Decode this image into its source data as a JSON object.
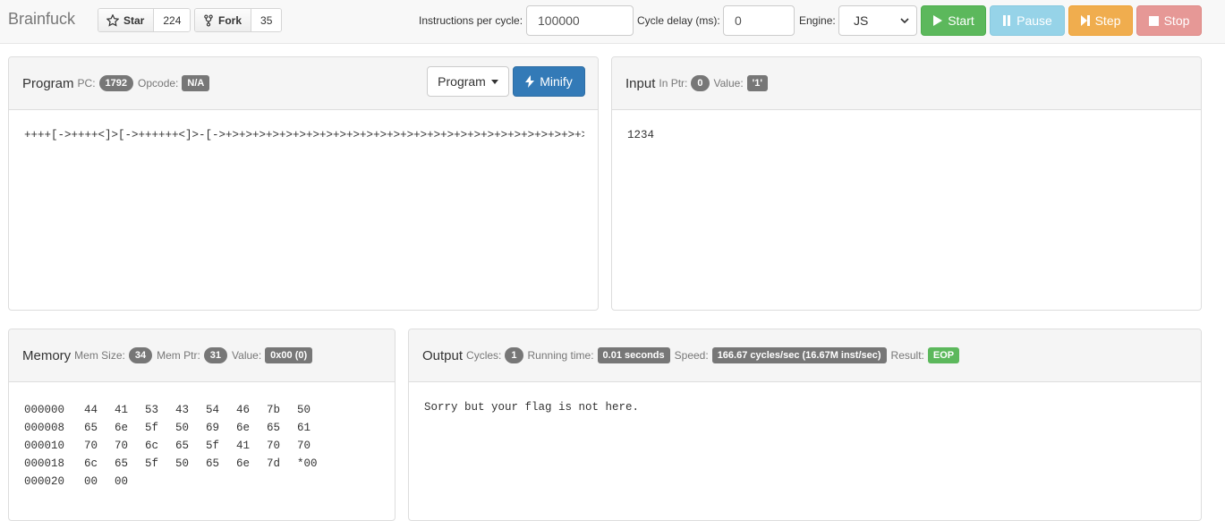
{
  "navbar": {
    "brand": "Brainfuck",
    "star": {
      "label": "Star",
      "count": "224"
    },
    "fork": {
      "label": "Fork",
      "count": "35"
    },
    "ipc_label": "Instructions per cycle:",
    "ipc_value": "100000",
    "delay_label": "Cycle delay (ms):",
    "delay_value": "0",
    "engine_label": "Engine:",
    "engine_value": "JS",
    "start": "Start",
    "pause": "Pause",
    "step": "Step",
    "stop": "Stop"
  },
  "program": {
    "title": "Program",
    "pc_label": "PC:",
    "pc_value": "1792",
    "opcode_label": "Opcode:",
    "opcode_value": "N/A",
    "dropdown_label": "Program",
    "minify_label": "Minify",
    "code": "++++[->++++<]>[->++++++<]>-[->+>+>+>+>+>+>+>+>+>+>+>+>+>+>+>+>+>+>+>+>+>+>+>+>+>+>+>+>+>+>+>+>+>+>+>+>+>+>+>+>+>+>+>+>+>+"
  },
  "input": {
    "title": "Input",
    "ptr_label": "In Ptr:",
    "ptr_value": "0",
    "value_label": "Value:",
    "value_value": "'1'",
    "content": "1234"
  },
  "memory": {
    "title": "Memory",
    "size_label": "Mem Size:",
    "size_value": "34",
    "ptr_label": "Mem Ptr:",
    "ptr_value": "31",
    "value_label": "Value:",
    "value_value": "0x00 (0)",
    "rows": [
      {
        "addr": "000000",
        "cells": [
          "44",
          "41",
          "53",
          "43",
          "54",
          "46",
          "7b",
          "50"
        ]
      },
      {
        "addr": "000008",
        "cells": [
          "65",
          "6e",
          "5f",
          "50",
          "69",
          "6e",
          "65",
          "61"
        ]
      },
      {
        "addr": "000010",
        "cells": [
          "70",
          "70",
          "6c",
          "65",
          "5f",
          "41",
          "70",
          "70"
        ]
      },
      {
        "addr": "000018",
        "cells": [
          "6c",
          "65",
          "5f",
          "50",
          "65",
          "6e",
          "7d",
          "*00"
        ]
      },
      {
        "addr": "000020",
        "cells": [
          "00",
          "00",
          "",
          "",
          "",
          "",
          "",
          ""
        ]
      }
    ]
  },
  "output": {
    "title": "Output",
    "cycles_label": "Cycles:",
    "cycles_value": "1",
    "time_label": "Running time:",
    "time_value": "0.01 seconds",
    "speed_label": "Speed:",
    "speed_value": "166.67 cycles/sec (16.67M inst/sec)",
    "result_label": "Result:",
    "result_value": "EOP",
    "content": "Sorry but your flag is not here."
  },
  "colors": {
    "start": "#5cb85c",
    "pause": "#96d3e8",
    "step": "#f0ad4e",
    "stop": "#e69896",
    "primary": "#337ab7",
    "badge": "#777777",
    "success": "#5cb85c"
  }
}
